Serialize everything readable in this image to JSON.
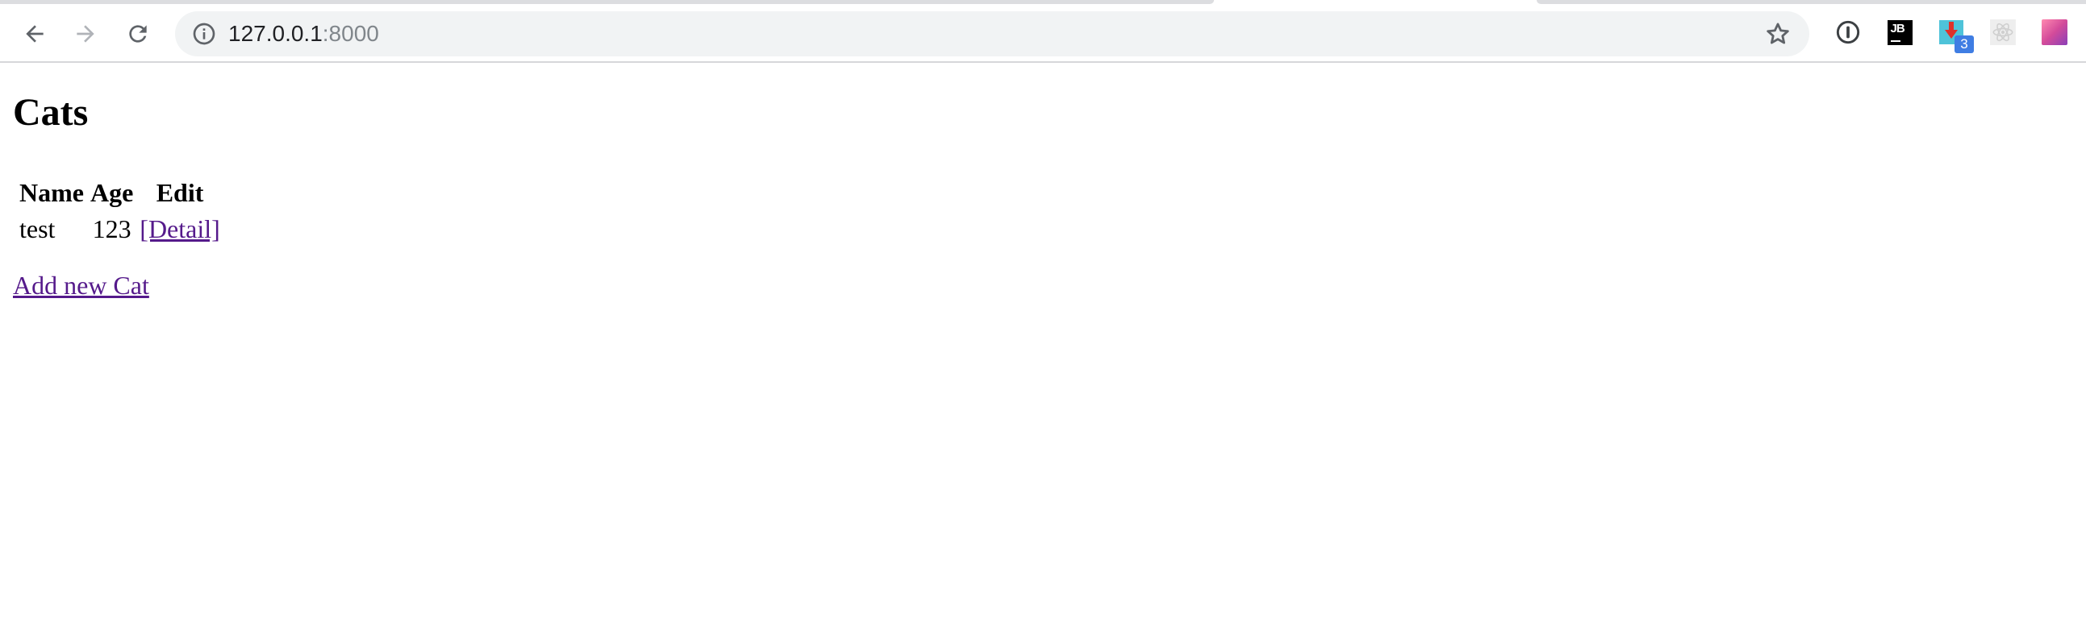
{
  "browser": {
    "url_host": "127.0.0.1",
    "url_port": ":8000",
    "extension_badge_count": "3",
    "jb_logo_text": "JB"
  },
  "page": {
    "title": "Cats",
    "table": {
      "headers": [
        "Name",
        "Age",
        "Edit"
      ],
      "rows": [
        {
          "name": "test",
          "age": "123",
          "edit_link": "[Detail]"
        }
      ]
    },
    "add_link": "Add new Cat"
  },
  "colors": {
    "visited_link": "#551a8b",
    "omnibox_bg": "#f1f3f4",
    "badge_blue": "#3f7de3"
  },
  "icons": {
    "back": "arrow-left-icon",
    "forward": "arrow-right-icon",
    "reload": "reload-icon",
    "info": "info-icon",
    "bookmark": "star-icon"
  }
}
